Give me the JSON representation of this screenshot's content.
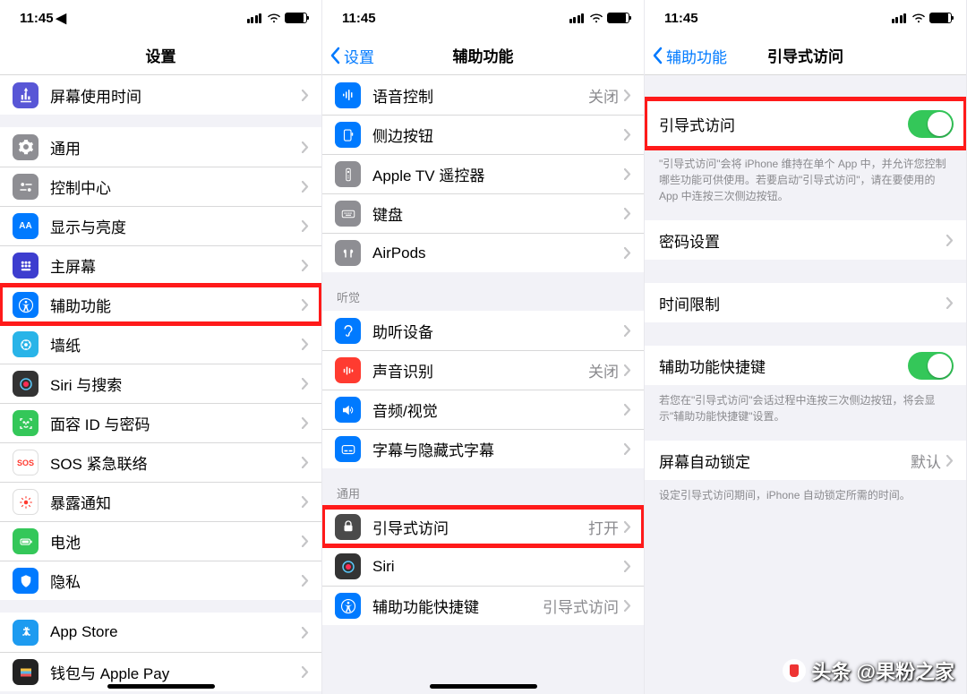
{
  "status": {
    "time": "11:45"
  },
  "screen1": {
    "title": "设置",
    "rows": {
      "screentime": "屏幕使用时间",
      "general": "通用",
      "control_center": "控制中心",
      "display": "显示与亮度",
      "homescreen": "主屏幕",
      "accessibility": "辅助功能",
      "wallpaper": "墙纸",
      "siri": "Siri 与搜索",
      "faceid": "面容 ID 与密码",
      "sos": "SOS 紧急联络",
      "exposure": "暴露通知",
      "battery": "电池",
      "privacy": "隐私",
      "appstore": "App Store",
      "wallet": "钱包与 Apple Pay"
    }
  },
  "screen2": {
    "back": "设置",
    "title": "辅助功能",
    "rows": {
      "voice_control": "语音控制",
      "side_button": "侧边按钮",
      "apple_tv": "Apple TV 遥控器",
      "keyboard": "键盘",
      "airpods": "AirPods",
      "hearing_devices": "助听设备",
      "sound_recognition": "声音识别",
      "audio_visual": "音频/视觉",
      "subtitles": "字幕与隐藏式字幕",
      "guided_access": "引导式访问",
      "siri": "Siri",
      "shortcut": "辅助功能快捷键"
    },
    "values": {
      "voice_control": "关闭",
      "sound_recognition": "关闭",
      "guided_access": "打开",
      "shortcut": "引导式访问"
    },
    "headers": {
      "hearing": "听觉",
      "general": "通用"
    }
  },
  "screen3": {
    "back": "辅助功能",
    "title": "引导式访问",
    "rows": {
      "guided_access": "引导式访问",
      "passcode": "密码设置",
      "time_limits": "时间限制",
      "shortcut": "辅助功能快捷键",
      "autolock": "屏幕自动锁定"
    },
    "values": {
      "autolock": "默认"
    },
    "notes": {
      "guided": "\"引导式访问\"会将 iPhone 维持在单个 App 中，并允许您控制哪些功能可供使用。若要启动\"引导式访问\"，请在要使用的 App 中连按三次侧边按钮。",
      "shortcut": "若您在\"引导式访问\"会话过程中连按三次侧边按钮，将会显示\"辅助功能快捷键\"设置。",
      "autolock": "设定引导式访问期间，iPhone 自动锁定所需的时间。"
    }
  },
  "watermark": "头条 @果粉之家"
}
